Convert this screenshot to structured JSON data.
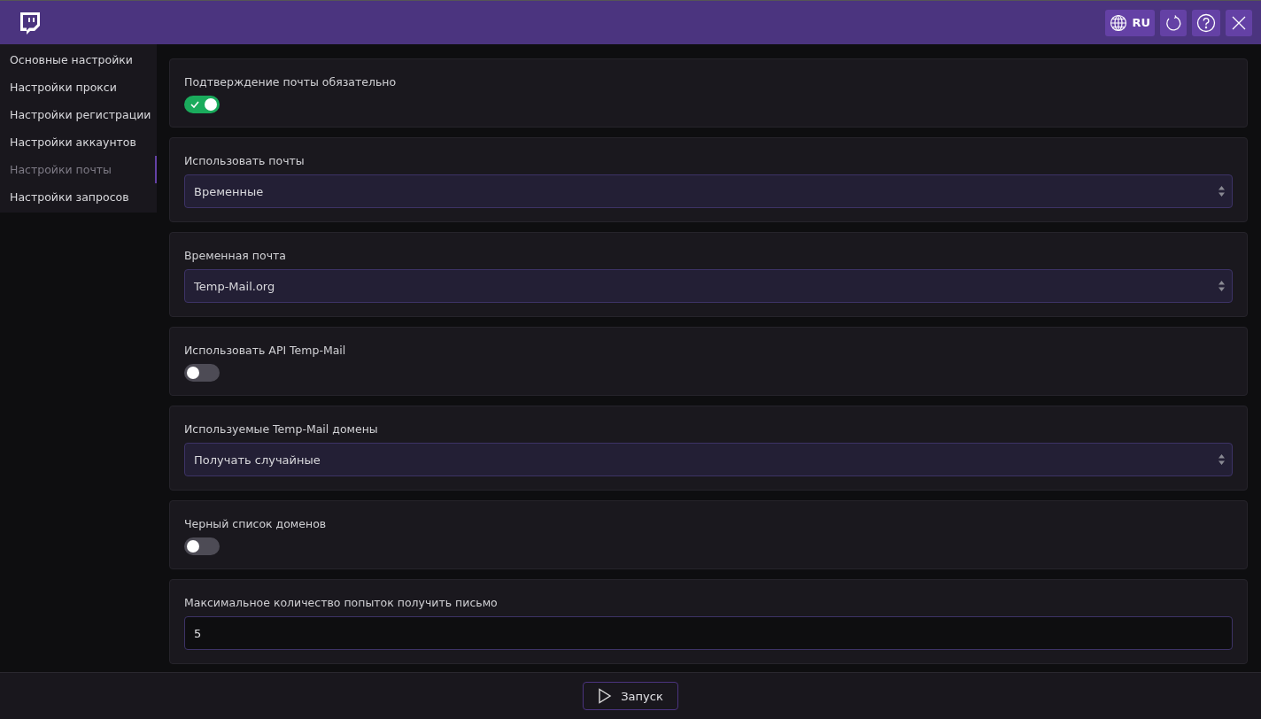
{
  "header": {
    "language": "RU"
  },
  "sidebar": {
    "items": [
      {
        "label": "Основные настройки",
        "selected": false
      },
      {
        "label": "Настройки прокси",
        "selected": false
      },
      {
        "label": "Настройки регистрации",
        "selected": false
      },
      {
        "label": "Настройки аккаунтов",
        "selected": false
      },
      {
        "label": "Настройки почты",
        "selected": true
      },
      {
        "label": "Настройки запросов",
        "selected": false
      }
    ]
  },
  "settings": [
    {
      "kind": "toggle",
      "label": "Подтверждение почты обязательно",
      "on": true
    },
    {
      "kind": "select",
      "label": "Использовать почты",
      "value": "Временные"
    },
    {
      "kind": "select",
      "label": "Временная почта",
      "value": "Temp-Mail.org"
    },
    {
      "kind": "toggle",
      "label": "Использовать API Temp-Mail",
      "on": false
    },
    {
      "kind": "select",
      "label": "Используемые Temp-Mail домены",
      "value": "Получать случайные"
    },
    {
      "kind": "toggle",
      "label": "Черный список доменов",
      "on": false
    },
    {
      "kind": "input",
      "label": "Максимальное количество попыток получить письмо",
      "value": "5"
    }
  ],
  "footer": {
    "button": "Запуск"
  }
}
